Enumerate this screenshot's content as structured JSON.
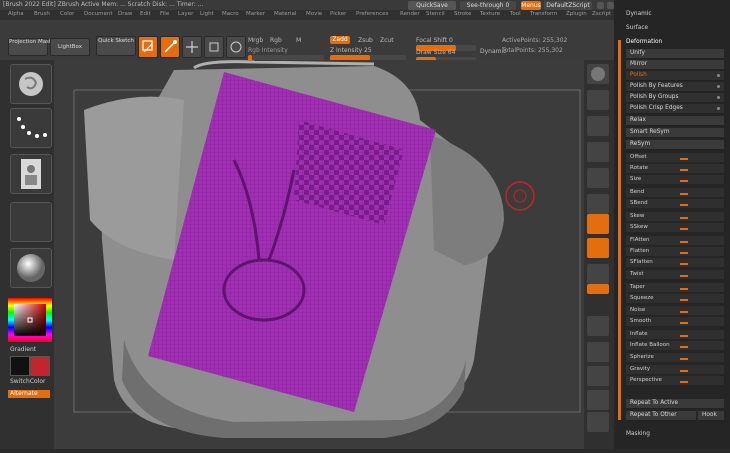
{
  "app": {
    "title": "[Brush 2022 Edit]   ZBrush Active Mem: ...   Scratch Disk: ...   Timer: ...",
    "quicksave": "QuickSave",
    "seethrough": "See-through  0",
    "menus_label": "Menus",
    "defaultzscript": "DefaultZScript"
  },
  "menubar": {
    "items": [
      "Alpha",
      "Brush",
      "Color",
      "Document",
      "Draw",
      "Edit",
      "File",
      "Layer",
      "Light",
      "Macro",
      "Marker",
      "Material",
      "Movie",
      "Picker",
      "Preferences",
      "Render",
      "Stencil",
      "Stroke",
      "Texture",
      "Tool",
      "Transform",
      "Zplugin",
      "Zscript"
    ]
  },
  "shelf": {
    "projections": "Projection Master",
    "lightbox": "LightBox",
    "quicksketch": "Quick Sketch",
    "edit": "Edit",
    "draw": "Draw",
    "move": "Move",
    "scale": "Scale",
    "rotate": "Rotate",
    "mrgb": "Mrgb",
    "rgb": "Rgb",
    "m": "M",
    "rgb_intensity": "Rgb Intensity",
    "zadd": "Zadd",
    "zsub": "Zsub",
    "zcut": "Zcut",
    "z_intensity": "Z Intensity 25",
    "focal_shift": "Focal Shift 0",
    "draw_size": "Draw Size 64",
    "dynamic": "Dynamic",
    "active_points": "ActivePoints: 255,302",
    "total_points": "TotalPoints: 255,302"
  },
  "lefttray": {
    "color_label": "Gradient",
    "switch_color": "SwitchColor",
    "alternate": "Alternate"
  },
  "palette": {
    "header_top": "Dynamic",
    "surface": "Surface",
    "deformation": "Deformation",
    "unify": "Unify",
    "mirror": "Mirror",
    "polish": "Polish",
    "polish_features": "Polish By Features",
    "polish_groups": "Polish By Groups",
    "polish_crisp": "Polish Crisp Edges",
    "relax": "Relax",
    "smart_resym": "Smart ReSym",
    "resym": "ReSym",
    "sliders": [
      "Offset",
      "Rotate",
      "Size",
      "Bend",
      "SBend",
      "Skew",
      "SSkew",
      "FlAtten",
      "Flatten",
      "SFlatten",
      "Twist",
      "Taper",
      "Squeeze",
      "Noise",
      "Smooth",
      "Inflate",
      "Inflate Balloon",
      "Spherize",
      "Gravity",
      "Perspective"
    ],
    "slider_values": [
      0,
      0,
      0,
      0,
      0,
      0,
      0,
      0,
      0,
      0,
      0,
      0,
      0,
      0,
      0,
      0,
      0,
      0,
      0,
      0
    ],
    "repeat_active": "Repeat To Active",
    "repeat_other": "Repeat To Other",
    "hook": "Hook",
    "masking": "Masking"
  },
  "colors": {
    "accent": "#e46e0d",
    "mesh": "#9a27b0"
  }
}
